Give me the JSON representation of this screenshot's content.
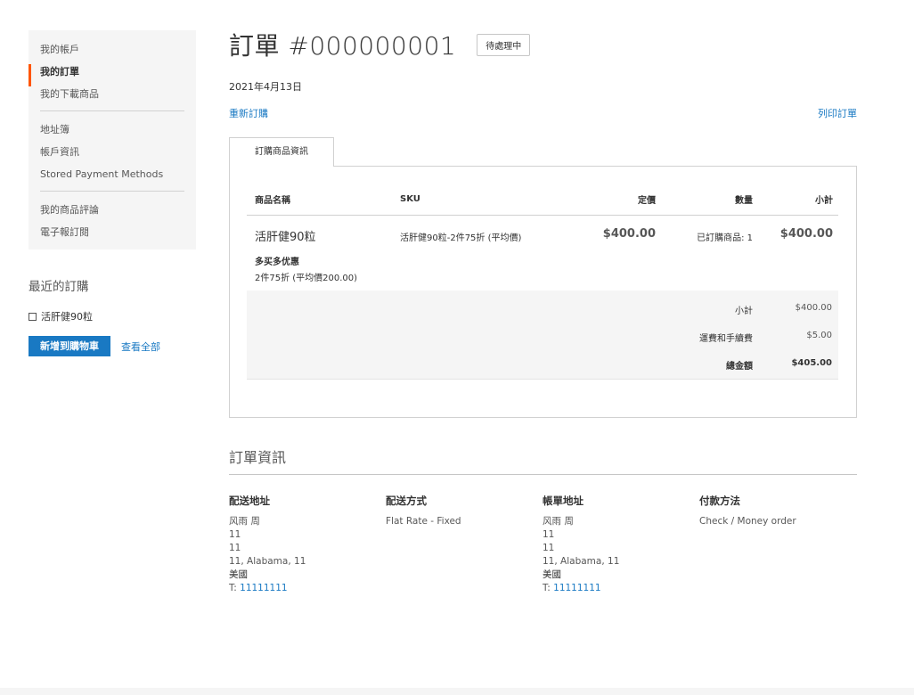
{
  "sidebar": {
    "items": [
      {
        "label": "我的帳戶"
      },
      {
        "label": "我的訂單"
      },
      {
        "label": "我的下載商品"
      },
      {
        "label": "地址簿"
      },
      {
        "label": "帳戶資訊"
      },
      {
        "label": "Stored Payment Methods"
      },
      {
        "label": "我的商品評論"
      },
      {
        "label": "電子報訂閱"
      }
    ],
    "active_index": 1
  },
  "recent": {
    "title": "最近的訂購",
    "item_name": "活肝健90粒",
    "add_to_cart_label": "新增到購物車",
    "view_all_label": "查看全部"
  },
  "order": {
    "title": "訂單 #000000001",
    "status": "待處理中",
    "date": "2021年4月13日",
    "reorder_label": "重新訂購",
    "print_label": "列印訂單",
    "tab_label": "訂購商品資訊",
    "columns": {
      "name": "商品名稱",
      "sku": "SKU",
      "price": "定價",
      "qty": "數量",
      "subtotal": "小計"
    },
    "item": {
      "name": "活肝健90粒",
      "option_label": "多买多优惠",
      "option_value": "2件75折 (平均價200.00)",
      "sku": "活肝健90粒-2件75折 (平均價)",
      "price": "$400.00",
      "qty": "已訂購商品: 1",
      "subtotal": "$400.00"
    },
    "totals": {
      "subtotal_label": "小計",
      "subtotal_value": "$400.00",
      "shipping_label": "運費和手續費",
      "shipping_value": "$5.00",
      "grand_label": "總金額",
      "grand_value": "$405.00"
    }
  },
  "info": {
    "title": "訂單資訊",
    "shipping_address": {
      "heading": "配送地址",
      "name": "风雨 周",
      "line1": "11",
      "line2": "11",
      "city": "11, Alabama, 11",
      "country": "美國",
      "phone_prefix": "T: ",
      "phone": "11111111"
    },
    "shipping_method": {
      "heading": "配送方式",
      "value": "Flat Rate - Fixed"
    },
    "billing_address": {
      "heading": "帳單地址",
      "name": "风雨 周",
      "line1": "11",
      "line2": "11",
      "city": "11, Alabama, 11",
      "country": "美國",
      "phone_prefix": "T: ",
      "phone": "11111111"
    },
    "payment_method": {
      "heading": "付款方法",
      "value": "Check / Money order"
    }
  },
  "colors": {
    "link": "#1979c3",
    "active_accent": "#ff5501",
    "panel_bg": "#f5f5f5"
  }
}
